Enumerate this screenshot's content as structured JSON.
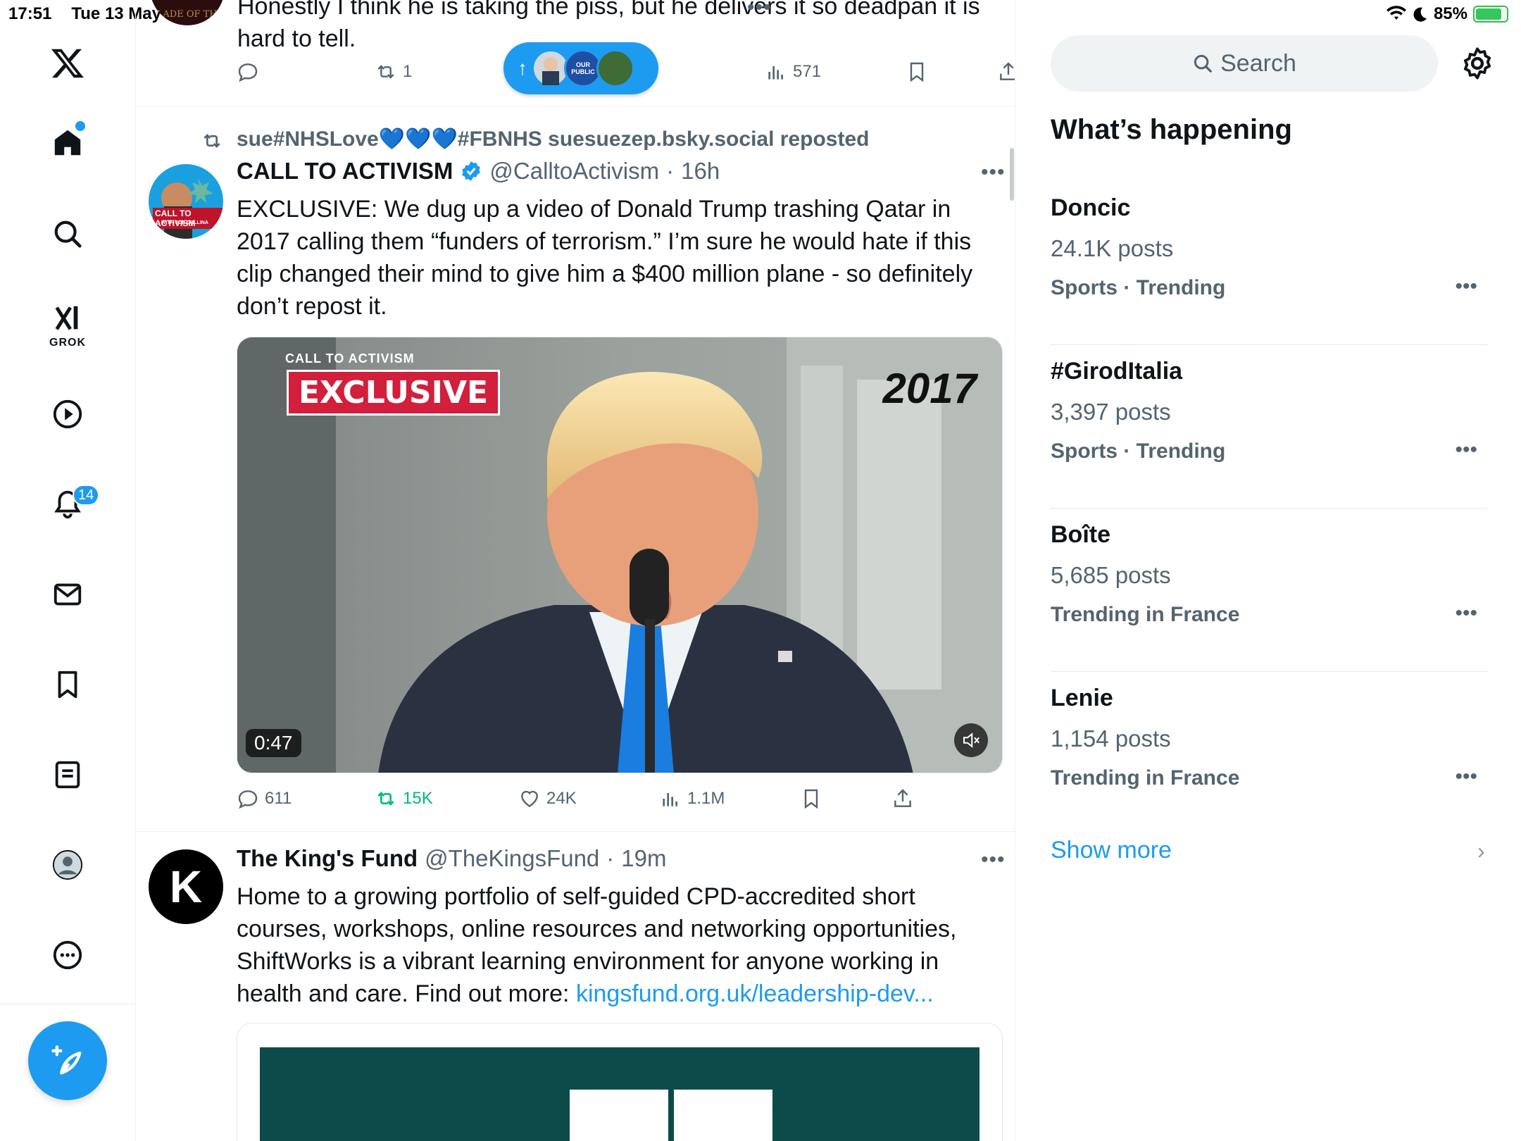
{
  "status_bar": {
    "time": "17:51",
    "date": "Tue 13 May",
    "battery": "85%",
    "battery_level": 0.85
  },
  "nav": {
    "grok_label": "GROK",
    "notifications_badge": "14",
    "icons": [
      "x-logo-icon",
      "home-icon",
      "search-icon",
      "grok-icon",
      "video-icon",
      "notifications-icon",
      "messages-icon",
      "bookmarks-icon",
      "lists-icon",
      "profile-icon",
      "more-icon",
      "compose-icon"
    ]
  },
  "new_posts_pill": {
    "arrow": "↑",
    "avatar_text": "OUR PUBLIC"
  },
  "prev_post": {
    "avatar_text": "SLADE OF THE",
    "text_line1": "Honestly I think he is taking the piss, but he delivers it so deadpan it is",
    "text_line2": "hard to tell.",
    "retweets": "1",
    "views": "571"
  },
  "post1": {
    "repost_by": "sue#NHSLove💙💙💙#FBNHS suesuezep.bsky.social reposted",
    "author": "CALL TO ACTIVISM",
    "handle": "@CalltoActivism",
    "time": "16h",
    "avatar_text": "CALL TO ACTIVISM",
    "avatar_subtext": "WITH JOE GALLINA",
    "text": "EXCLUSIVE: We dug up a video of Donald Trump trashing Qatar in 2017 calling them “funders of terrorism.” I’m sure he would hate if this clip changed their mind to give him a $400 million plane - so definitely don’t repost it.",
    "media": {
      "brand": "CALL TO ACTIVISM",
      "banner": "EXCLUSIVE",
      "year": "2017",
      "duration": "0:47"
    },
    "replies": "611",
    "reposts": "15K",
    "likes": "24K",
    "views": "1.1M"
  },
  "post2": {
    "author": "The King's Fund",
    "handle": "@TheKingsFund",
    "time": "19m",
    "avatar_letter": "K",
    "text": "Home to a growing portfolio of self-guided CPD-accredited short courses, workshops, online resources and networking opportunities, ShiftWorks is a vibrant learning environment for anyone working in health and care. Find out more: ",
    "link": "kingsfund.org.uk/leadership-dev..."
  },
  "sidebar": {
    "search_placeholder": "Search",
    "title": "What’s happening",
    "trends": [
      {
        "name": "Doncic",
        "count": "24.1K posts",
        "context": "Sports · Trending"
      },
      {
        "name": "#GirodItalia",
        "count": "3,397 posts",
        "context": "Sports · Trending"
      },
      {
        "name": "Boîte",
        "count": "5,685 posts",
        "context": "Trending in France"
      },
      {
        "name": "Lenie",
        "count": "1,154 posts",
        "context": "Trending in France"
      }
    ],
    "show_more": "Show more"
  },
  "colors": {
    "accent": "#1d9bf0",
    "repost_green": "#00ba7c",
    "text": "#0f1419",
    "secondary": "#536471"
  }
}
